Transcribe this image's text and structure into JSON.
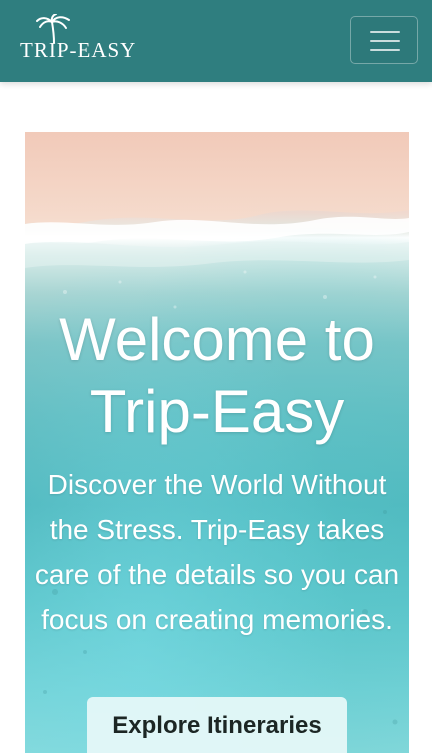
{
  "navbar": {
    "brand_text": "TRIP-EASY",
    "brand_icon": "palm-tree-icon",
    "toggler_icon": "hamburger-menu-icon",
    "background": "#2f7e7f"
  },
  "hero": {
    "title": "Welcome to Trip-Easy",
    "subtitle": "Discover the World Without the Stress. Trip-Easy takes care of the details so you can focus on creating memories.",
    "cta_label": "Explore Itineraries"
  }
}
